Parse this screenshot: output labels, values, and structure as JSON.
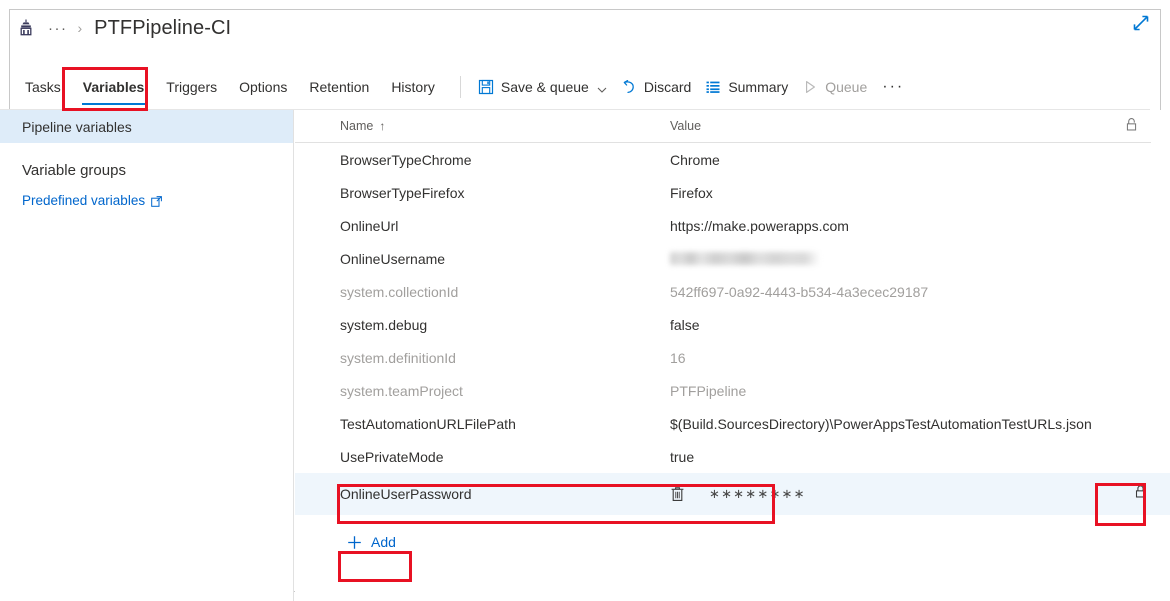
{
  "breadcrumb": {
    "icon": "pipeline-icon",
    "ellipsis": "···",
    "separator": "›",
    "title": "PTFPipeline-CI"
  },
  "toolbar": {
    "tabs": [
      {
        "label": "Tasks",
        "active": false
      },
      {
        "label": "Variables",
        "active": true
      },
      {
        "label": "Triggers",
        "active": false
      },
      {
        "label": "Options",
        "active": false
      },
      {
        "label": "Retention",
        "active": false
      },
      {
        "label": "History",
        "active": false
      }
    ],
    "actions": [
      {
        "label": "Save & queue",
        "icon": "save-icon",
        "has_chevron": true,
        "disabled": false
      },
      {
        "label": "Discard",
        "icon": "undo-icon",
        "has_chevron": false,
        "disabled": false
      },
      {
        "label": "Summary",
        "icon": "list-icon",
        "has_chevron": false,
        "disabled": false
      },
      {
        "label": "Queue",
        "icon": "play-icon",
        "has_chevron": false,
        "disabled": true
      }
    ],
    "overflow_label": "···",
    "expand_icon": "expand-diagonal-icon"
  },
  "sidebar": {
    "items": [
      {
        "label": "Pipeline variables",
        "selected": true
      },
      {
        "label": "Variable groups",
        "selected": false
      }
    ],
    "link": {
      "label": "Predefined variables",
      "icon": "external-link-icon"
    }
  },
  "table": {
    "columns": {
      "name": "Name",
      "sort_indicator": "↑",
      "value": "Value",
      "lock_icon": "lock-open-icon"
    },
    "rows": [
      {
        "name": "BrowserTypeChrome",
        "value": "Chrome",
        "dim": false,
        "secret": false
      },
      {
        "name": "BrowserTypeFirefox",
        "value": "Firefox",
        "dim": false,
        "secret": false
      },
      {
        "name": "OnlineUrl",
        "value": "https://make.powerapps.com",
        "dim": false,
        "secret": false
      },
      {
        "name": "OnlineUsername",
        "value": "",
        "dim": false,
        "secret": false,
        "redacted": true
      },
      {
        "name": "system.collectionId",
        "value": "542ff697-0a92-4443-b534-4a3ecec29187",
        "dim": true,
        "secret": false
      },
      {
        "name": "system.debug",
        "value": "false",
        "dim": false,
        "secret": false
      },
      {
        "name": "system.definitionId",
        "value": "16",
        "dim": true,
        "secret": false
      },
      {
        "name": "system.teamProject",
        "value": "PTFPipeline",
        "dim": true,
        "secret": false
      },
      {
        "name": "TestAutomationURLFilePath",
        "value": "$(Build.SourcesDirectory)\\PowerAppsTestAutomationTestURLs.json",
        "dim": false,
        "secret": false
      },
      {
        "name": "UsePrivateMode",
        "value": "true",
        "dim": false,
        "secret": false
      }
    ],
    "selected_row": {
      "name": "OnlineUserPassword",
      "masked_value": "∗∗∗∗∗∗∗∗",
      "delete_icon": "trash-icon",
      "lock_icon": "lock-closed-icon"
    },
    "add_button": {
      "label": "Add",
      "icon": "plus-icon"
    }
  },
  "annotations": {
    "highlight_color": "#e81123",
    "boxes": [
      {
        "target": "variables-tab"
      },
      {
        "target": "password-row"
      },
      {
        "target": "lock-cell"
      },
      {
        "target": "add-button"
      }
    ]
  },
  "colors": {
    "accent": "#0078d4",
    "link": "#0066cc",
    "selected_bg": "#deecf9",
    "row_selected_bg": "#eff6fc",
    "text": "#323130",
    "dim_text": "#a19f9d"
  }
}
